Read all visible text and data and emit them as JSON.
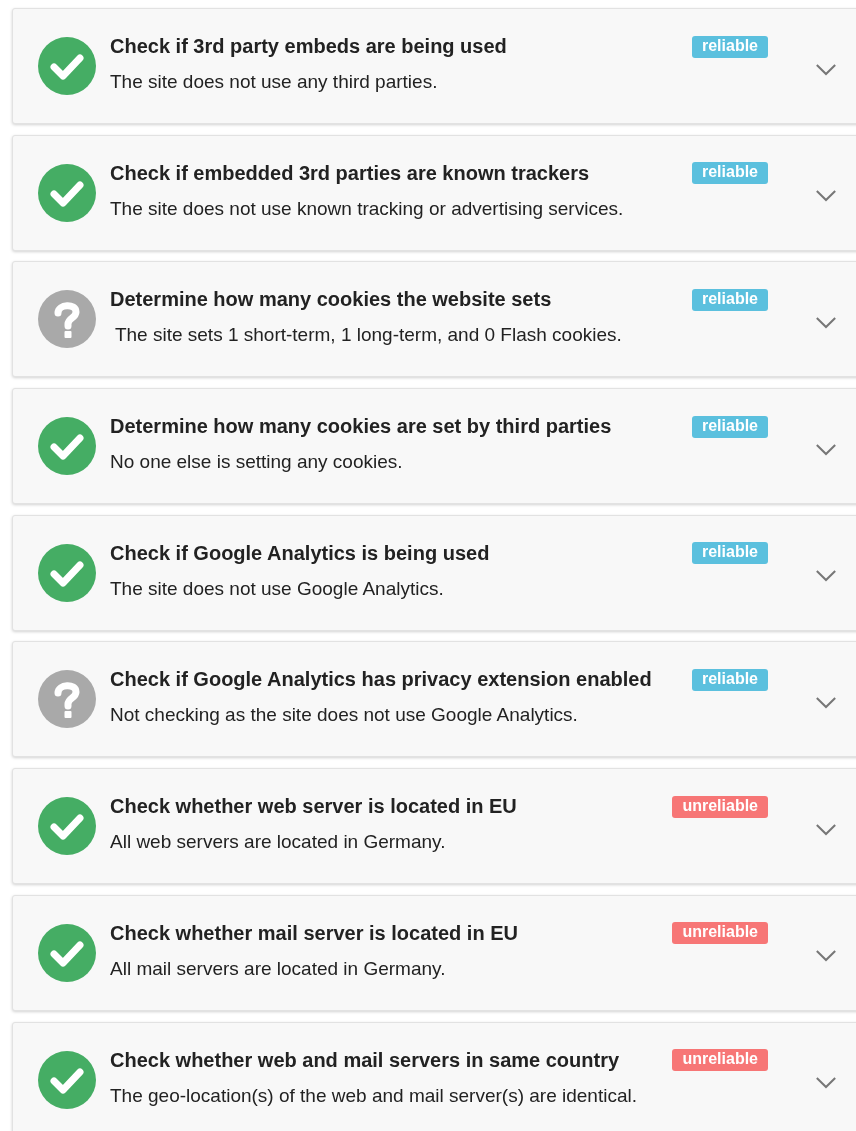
{
  "checks": [
    {
      "kind": "pass",
      "title": "Check if 3rd party embeds are being used",
      "badge": {
        "text": "reliable",
        "color": "#5bc0de"
      },
      "description": "The site does not use any third parties."
    },
    {
      "kind": "pass",
      "title": "Check if embedded 3rd parties are known trackers",
      "badge": {
        "text": "reliable",
        "color": "#5bc0de"
      },
      "description": "The site does not use known tracking or advertising services."
    },
    {
      "kind": "unknown",
      "title": "Determine how many cookies the website sets",
      "badge": {
        "text": "reliable",
        "color": "#5bc0de"
      },
      "description": " The site sets 1 short-term, 1 long-term, and 0 Flash cookies."
    },
    {
      "kind": "pass",
      "title": "Determine how many cookies are set by third parties",
      "badge": {
        "text": "reliable",
        "color": "#5bc0de"
      },
      "description": "No one else is setting any cookies."
    },
    {
      "kind": "pass",
      "title": "Check if Google Analytics is being used",
      "badge": {
        "text": "reliable",
        "color": "#5bc0de"
      },
      "description": "The site does not use Google Analytics."
    },
    {
      "kind": "unknown",
      "title": "Check if Google Analytics has privacy extension enabled",
      "badge": {
        "text": "reliable",
        "color": "#5bc0de"
      },
      "description": "Not checking as the site does not use Google Analytics."
    },
    {
      "kind": "pass",
      "title": "Check whether web server is located in EU",
      "badge": {
        "text": "unreliable",
        "color": "#f77676"
      },
      "description": "All web servers are located in Germany."
    },
    {
      "kind": "pass",
      "title": "Check whether mail server is located in EU",
      "badge": {
        "text": "unreliable",
        "color": "#f77676"
      },
      "description": "All mail servers are located in Germany."
    },
    {
      "kind": "pass",
      "title": "Check whether web and mail servers in same country",
      "badge": {
        "text": "unreliable",
        "color": "#f77676"
      },
      "description": "The geo-location(s) of the web and mail server(s) are identical."
    }
  ]
}
